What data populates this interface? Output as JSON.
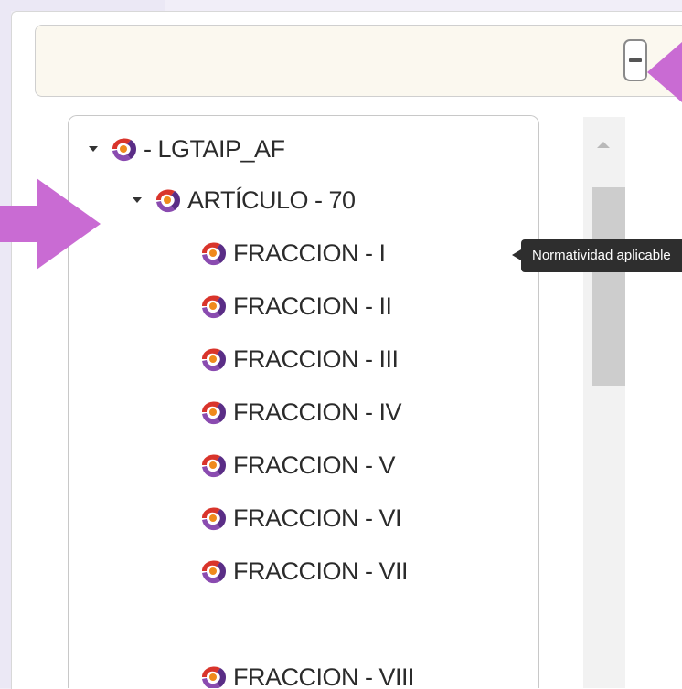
{
  "header": {
    "collapse_button_icon": "minus-icon"
  },
  "tree": {
    "root": {
      "label": "- LGTAIP_AF",
      "expanded": true,
      "icon": "institution-logo-icon"
    },
    "article": {
      "label": "ARTÍCULO - 70",
      "expanded": true,
      "icon": "institution-logo-icon"
    },
    "fractions": [
      {
        "label": "FRACCION - I"
      },
      {
        "label": "FRACCION - II"
      },
      {
        "label": "FRACCION - III"
      },
      {
        "label": "FRACCION - IV"
      },
      {
        "label": "FRACCION - V"
      },
      {
        "label": "FRACCION - VI"
      },
      {
        "label": "FRACCION - VII"
      },
      {
        "label": "FRACCION - VIII"
      }
    ]
  },
  "tooltip": {
    "text": "Normatividad aplicable"
  },
  "colors": {
    "annotation_arrow": "#c96bd3",
    "logo_red": "#d9342b",
    "logo_purple": "#5a2d86",
    "logo_orange": "#f08a1c"
  }
}
